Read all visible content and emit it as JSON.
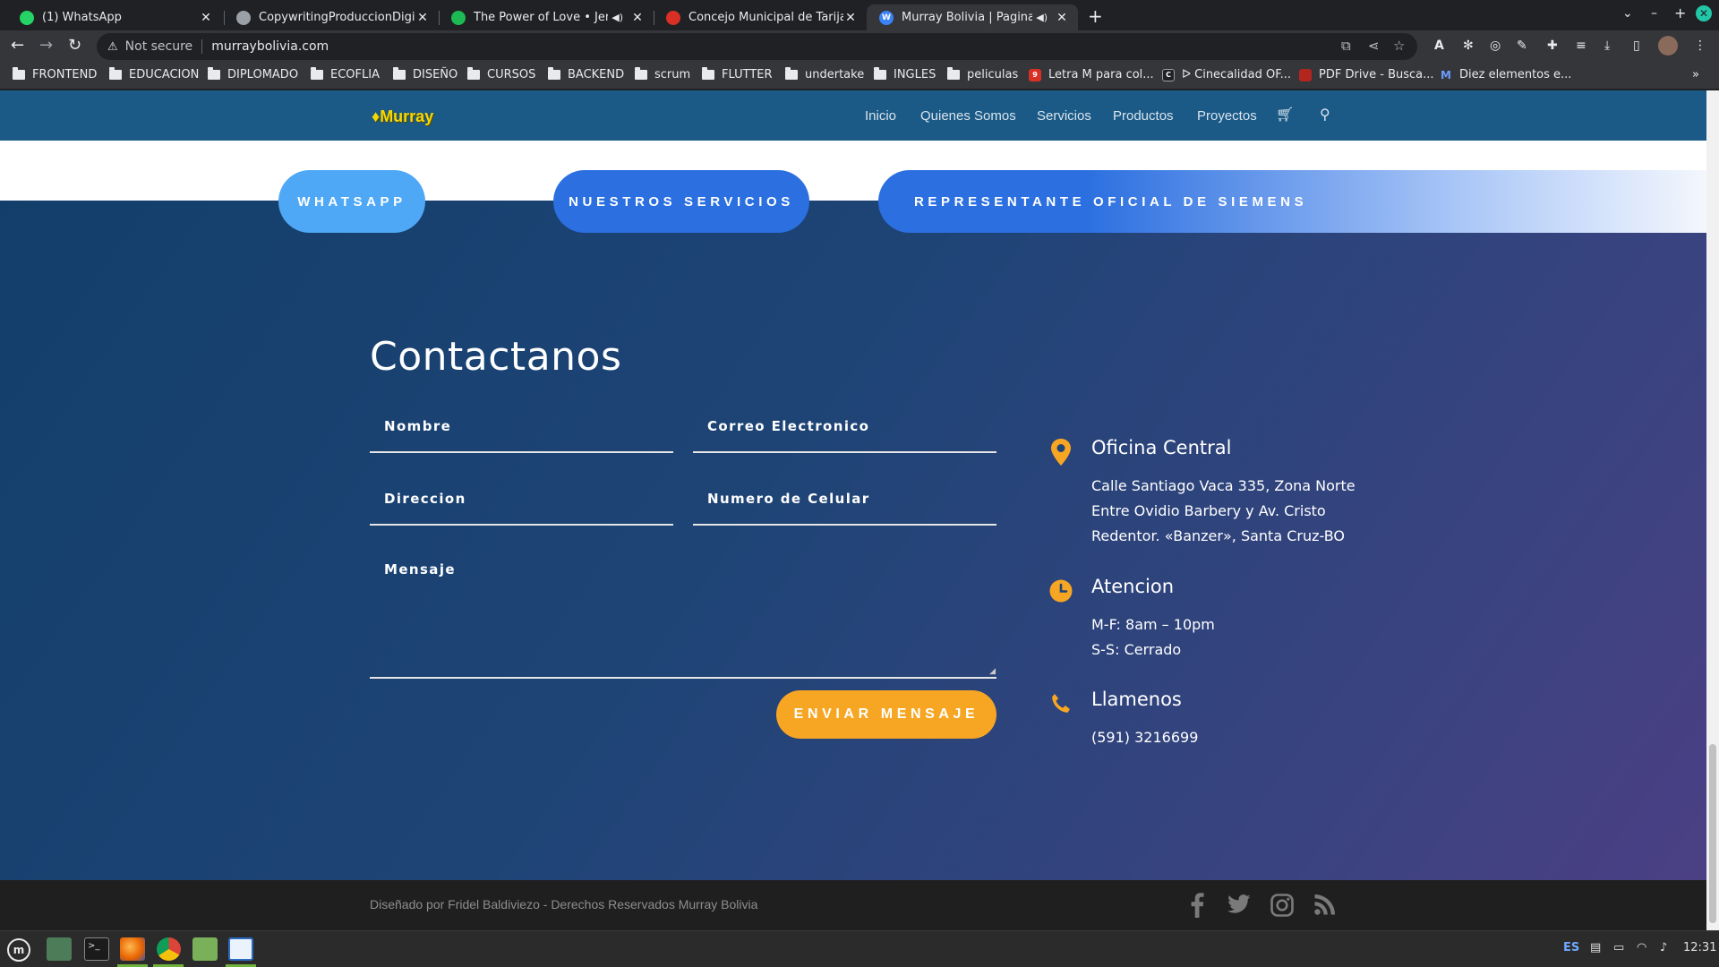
{
  "browser": {
    "tabs": [
      {
        "title": "(1) WhatsApp",
        "favicon_color": "#25d366",
        "audio": false,
        "active": false
      },
      {
        "title": "CopywritingProduccionDigital",
        "favicon_color": "#5f6368",
        "audio": false,
        "active": false
      },
      {
        "title": "The Power of Love • Jenni",
        "favicon_color": "#1db954",
        "audio": true,
        "active": false
      },
      {
        "title": "Concejo Municipal de Tarija",
        "favicon_color": "#d93025",
        "audio": false,
        "active": false
      },
      {
        "title": "Murray Bolivia | Pagina Of",
        "favicon_color": "#3b82f6",
        "audio": true,
        "active": true
      }
    ],
    "new_tab_glyph": "+",
    "security_label": "Not secure",
    "url": "murraybolivia.com",
    "bookmarks": [
      {
        "label": "FRONTEND",
        "type": "folder"
      },
      {
        "label": "EDUCACION",
        "type": "folder"
      },
      {
        "label": "DIPLOMADO",
        "type": "folder"
      },
      {
        "label": "ECOFLIA",
        "type": "folder"
      },
      {
        "label": "DISEÑO",
        "type": "folder"
      },
      {
        "label": "CURSOS",
        "type": "folder"
      },
      {
        "label": "BACKEND",
        "type": "folder"
      },
      {
        "label": "scrum",
        "type": "folder"
      },
      {
        "label": "FLUTTER",
        "type": "folder"
      },
      {
        "label": "undertake",
        "type": "folder"
      },
      {
        "label": "INGLES",
        "type": "folder"
      },
      {
        "label": "peliculas",
        "type": "folder"
      },
      {
        "label": "Letra M para col...",
        "type": "site",
        "color": "#d93025"
      },
      {
        "label": "ᐅ Cinecalidad OF...",
        "type": "site",
        "color": "#202124"
      },
      {
        "label": "PDF Drive - Busca...",
        "type": "site",
        "color": "#b3261e"
      },
      {
        "label": "Diez elementos e...",
        "type": "site",
        "color": "#3b6fd1"
      }
    ]
  },
  "site": {
    "logo": "Murray",
    "nav": [
      "Inicio",
      "Quienes Somos",
      "Servicios",
      "Productos",
      "Proyectos"
    ],
    "cta_buttons": [
      "WHATSAPP",
      "NUESTROS SERVICIOS",
      "REPRESENTANTE OFICIAL DE SIEMENS"
    ],
    "contact": {
      "title": "Contactanos",
      "fields": {
        "name": "Nombre",
        "email": "Correo Electronico",
        "address": "Direccion",
        "phone": "Numero de Celular",
        "message": "Mensaje"
      },
      "submit": "ENVIAR MENSAJE"
    },
    "info": {
      "office_title": "Oficina Central",
      "office_lines": [
        "Calle Santiago Vaca 335, Zona Norte",
        "Entre Ovidio Barbery y Av. Cristo",
        "Redentor. «Banzer», Santa Cruz-BO"
      ],
      "hours_title": "Atencion",
      "hours_lines": [
        "M-F: 8am – 10pm",
        "S-S: Cerrado"
      ],
      "call_title": "Llamenos",
      "phone": "(591) 3216699"
    },
    "footer": "Diseñado por Fridel Baldiviezo - Derechos Reservados Murray Bolivia",
    "accent": "#f7a623"
  },
  "taskbar": {
    "lang": "ES",
    "time": "12:31"
  }
}
